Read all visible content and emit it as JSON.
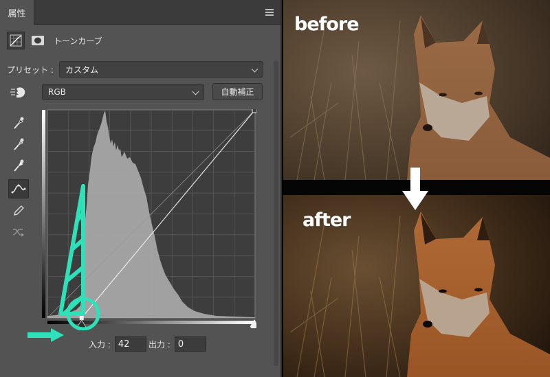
{
  "panel": {
    "tab_label": "属性",
    "adjustment_title": "トーンカーブ",
    "preset_label": "プリセット :",
    "preset_value": "カスタム",
    "channel_value": "RGB",
    "auto_button": "自動補正",
    "input_label": "入力 :",
    "input_value": "42",
    "output_label": "出力 :",
    "output_value": "0",
    "tools": [
      "on-image-adjust-icon",
      "black-eyedropper-icon",
      "gray-eyedropper-icon",
      "white-eyedropper-icon",
      "curve-point-icon",
      "pencil-icon",
      "smooth-icon"
    ]
  },
  "histogram": {
    "input_black_point": 42,
    "input_white_point": 255,
    "output_black_point": 0,
    "output_white_point": 255
  },
  "annotations": {
    "accent_color": "#2fe1b9"
  },
  "photos": {
    "before_caption": "before",
    "after_caption": "after"
  }
}
